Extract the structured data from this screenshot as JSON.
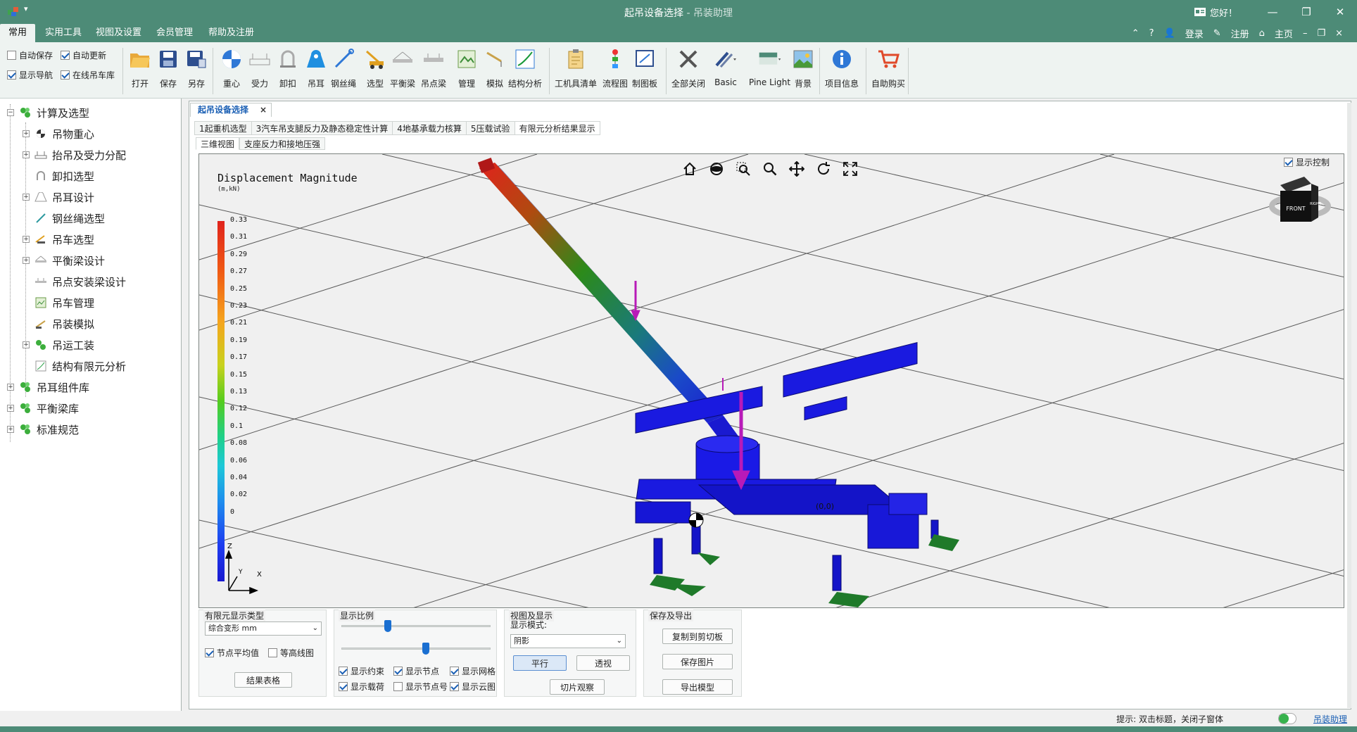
{
  "window": {
    "title": "起吊设备选择",
    "subtitle": "吊装助理",
    "greeting": "您好！",
    "minimize": "—",
    "restore": "❐",
    "close": "✕"
  },
  "menu": {
    "tabs": [
      "常用",
      "实用工具",
      "视图及设置",
      "会员管理",
      "帮助及注册"
    ],
    "right": {
      "login": "登录",
      "register": "注册",
      "home": "主页"
    }
  },
  "options": {
    "autosave": "自动保存",
    "autoupdate": "自动更新",
    "shownav": "显示导航",
    "onlinecrane": "在线吊车库"
  },
  "ribbon": {
    "open": "打开",
    "save": "保存",
    "saveas": "另存",
    "cog": "重心",
    "force": "受力",
    "shackle": "卸扣",
    "lug": "吊耳",
    "wirerope": "钢丝绳",
    "selection": "选型",
    "beam": "平衡梁",
    "pointbeam": "吊点梁",
    "manage": "管理",
    "simulate": "模拟",
    "analysis": "结构分析",
    "toollist": "工机具清单",
    "flowchart": "流程图",
    "board": "制图板",
    "closeall": "全部关闭",
    "basic": "Basic",
    "pinelight": "Pine Light",
    "background": "背景",
    "projinfo": "项目信息",
    "buy": "自助购买"
  },
  "tree": {
    "root": "计算及选型",
    "items": [
      "吊物重心",
      "抬吊及受力分配",
      "卸扣选型",
      "吊耳设计",
      "钢丝绳选型",
      "吊车选型",
      "平衡梁设计",
      "吊点安装梁设计",
      "吊车管理",
      "吊装模拟",
      "吊运工装",
      "结构有限元分析"
    ],
    "others": [
      "吊耳组件库",
      "平衡梁库",
      "标准规范"
    ]
  },
  "doc": {
    "tab": "起吊设备选择",
    "close": "×",
    "subtabs": [
      "1起重机选型",
      "3汽车吊支腿反力及静态稳定性计算",
      "4地基承载力核算",
      "5压载试验",
      "有限元分析结果显示"
    ],
    "subtabs2": [
      "三维视图",
      "支座反力和接地压强"
    ]
  },
  "viewport": {
    "title": "Displacement Magnitude",
    "unit": "(m,kN)",
    "legend": [
      "0.33",
      "0.31",
      "0.29",
      "0.27",
      "0.25",
      "0.23",
      "0.21",
      "0.19",
      "0.17",
      "0.15",
      "0.13",
      "0.12",
      "0.1",
      "0.08",
      "0.06",
      "0.04",
      "0.02",
      "0"
    ],
    "showctl": "显示控制",
    "coord": "(0,0)",
    "cube_front": "FRONT",
    "cube_right": "RIGHT",
    "axis_z": "Z",
    "axis_x": "X",
    "axis_y": "Y"
  },
  "panel": {
    "type": {
      "title": "有限元显示类型",
      "select": "综合变形 mm",
      "avg": "节点平均值",
      "contour": "等高线图",
      "table": "结果表格"
    },
    "scale": {
      "title": "显示比例",
      "slider1": 0.3,
      "slider2": 0.57,
      "checks": [
        "显示约束",
        "显示节点",
        "显示网格",
        "显示载荷",
        "显示节点号",
        "显示云图"
      ]
    },
    "view": {
      "title": "视图及显示",
      "mode_label": "显示模式:",
      "mode": "阴影",
      "parallel": "平行",
      "persp": "透视",
      "slice": "切片观察"
    },
    "export": {
      "title": "保存及导出",
      "copy": "复制到剪切板",
      "saveimg": "保存图片",
      "model": "导出模型"
    }
  },
  "status": {
    "hint": "提示: 双击标题，关闭子窗体",
    "link": "吊装助理"
  }
}
